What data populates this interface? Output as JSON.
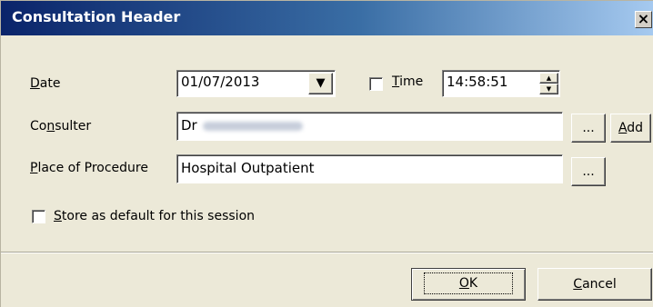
{
  "window": {
    "title": "Consultation Header"
  },
  "fields": {
    "date": {
      "label_first": "D",
      "label_rest": "ate",
      "value": "01/07/2013"
    },
    "time": {
      "label_first": "T",
      "label_rest": "ime",
      "value": "14:58:51"
    },
    "consulter": {
      "label_pre": "Co",
      "label_u": "n",
      "label_post": "sulter",
      "value_prefix": "Dr"
    },
    "place": {
      "label_first": "P",
      "label_rest": "lace of Procedure",
      "value": "Hospital Outpatient"
    },
    "store_default": {
      "label_first": "S",
      "label_rest": "tore as default for this session"
    }
  },
  "buttons": {
    "ellipsis": "...",
    "add": {
      "first": "A",
      "rest": "dd"
    },
    "ok": {
      "first": "O",
      "rest": "K"
    },
    "cancel": {
      "first": "C",
      "rest": "ancel"
    }
  },
  "icons": {
    "close": "×",
    "dropdown": "▼",
    "spin_up": "▲",
    "spin_down": "▼"
  }
}
